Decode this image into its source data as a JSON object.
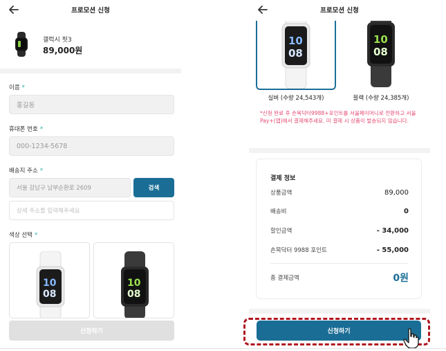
{
  "left": {
    "header": {
      "title": "프로모션 신청",
      "back_icon": "arrow-left-icon"
    },
    "product": {
      "name": "갤럭시 핏3",
      "price": "89,000원"
    },
    "fields": {
      "name": {
        "label": "이름",
        "value": "홍길동"
      },
      "phone": {
        "label": "휴대폰 번호",
        "value": "000-1234-5678"
      },
      "address": {
        "label": "배송지 주소",
        "value": "서울 강남구 남부순환로 2609",
        "search_label": "검색",
        "detail_placeholder": "상세 주소를 입력해주세요"
      },
      "color": {
        "label": "색상 선택"
      }
    },
    "required_mark": "*",
    "submit_label": "신청하기"
  },
  "right": {
    "header": {
      "title": "프로모션 신청",
      "back_icon": "arrow-left-icon"
    },
    "colors": [
      {
        "label": "실버 (수량 24,543개)",
        "selected": true
      },
      {
        "label": "블랙 (수량 24,385개)",
        "selected": false
      }
    ],
    "notice": "*신청 완료 후 손목닥터9988+포인트를 서울페이머니로 전환하고 서울Pay+(앱)에서 결제해주세요. 미 결제 시 상품이 발송되지 않습니다.",
    "payment": {
      "title": "결제 정보",
      "rows": [
        {
          "label": "상품금액",
          "value": "89,000"
        },
        {
          "label": "배송비",
          "value": "0"
        },
        {
          "label": "할인금액",
          "value": "- 34,000"
        },
        {
          "label": "손목닥터 9988 포인트",
          "value": "- 55,000"
        }
      ],
      "total_label": "총 결제금액",
      "total_value": "0원"
    },
    "submit_label": "신청하기",
    "pointer_icon": "hand-pointer-icon"
  },
  "colors": {
    "accent": "#1a6e96",
    "notice": "#e44a73",
    "required": "#2ab0a0",
    "highlight": "#b0141f"
  }
}
